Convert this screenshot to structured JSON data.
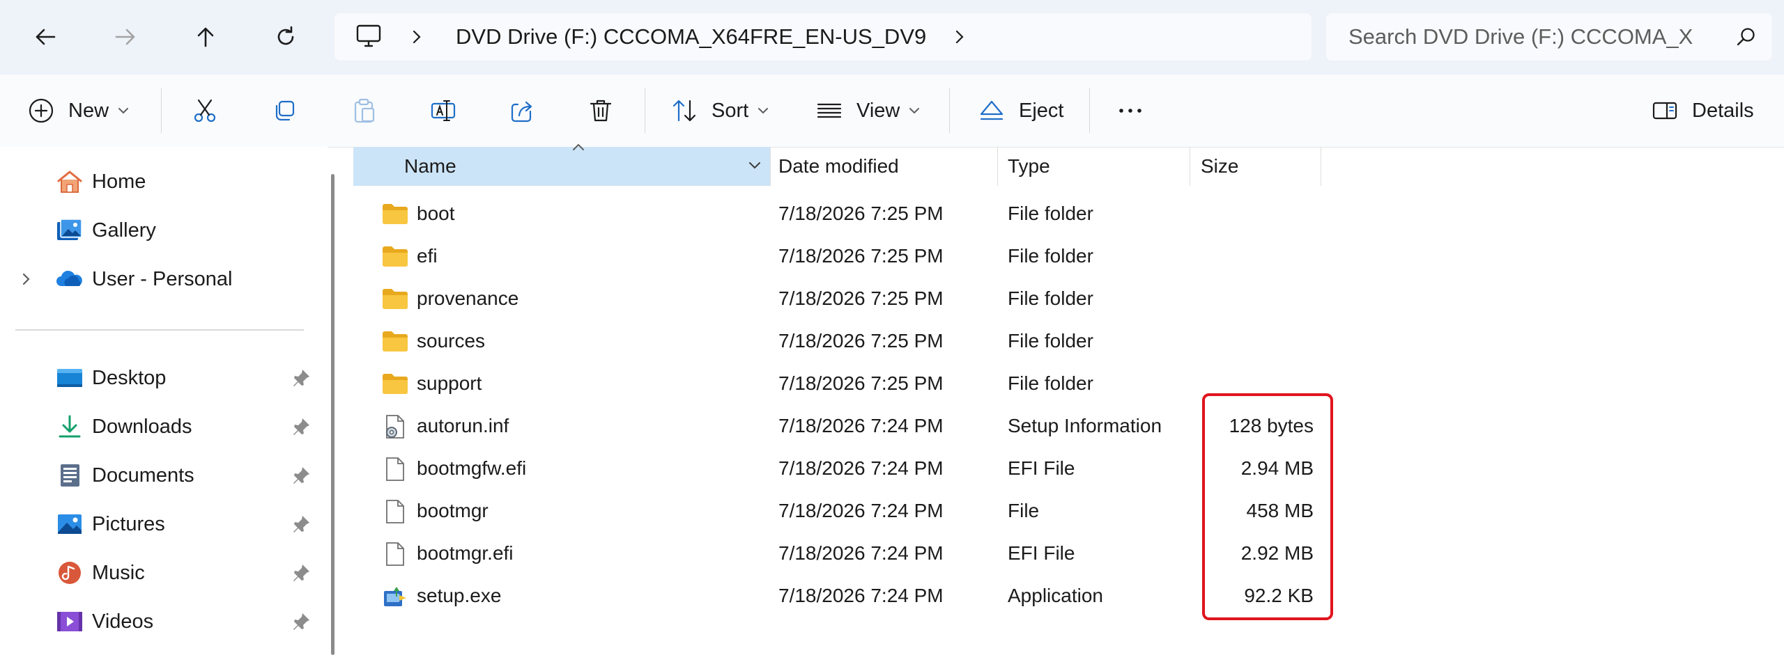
{
  "address": {
    "path": "DVD Drive (F:) CCCOMA_X64FRE_EN-US_DV9",
    "search_placeholder": "Search DVD Drive (F:) CCCOMA_X"
  },
  "toolbar": {
    "new_label": "New",
    "sort_label": "Sort",
    "view_label": "View",
    "eject_label": "Eject",
    "details_label": "Details"
  },
  "sidebar": {
    "top": [
      {
        "label": "Home",
        "icon": "home-icon"
      },
      {
        "label": "Gallery",
        "icon": "gallery-icon"
      },
      {
        "label": "User - Personal",
        "icon": "onedrive-icon"
      }
    ],
    "pinned": [
      {
        "label": "Desktop",
        "icon": "desktop-icon"
      },
      {
        "label": "Downloads",
        "icon": "downloads-icon"
      },
      {
        "label": "Documents",
        "icon": "documents-icon"
      },
      {
        "label": "Pictures",
        "icon": "pictures-icon"
      },
      {
        "label": "Music",
        "icon": "music-icon"
      },
      {
        "label": "Videos",
        "icon": "videos-icon"
      }
    ]
  },
  "columns": {
    "name": "Name",
    "date": "Date modified",
    "type": "Type",
    "size": "Size"
  },
  "files": [
    {
      "name": "boot",
      "date": "7/18/2026 7:25 PM",
      "type": "File folder",
      "size": "",
      "icon": "folder-icon"
    },
    {
      "name": "efi",
      "date": "7/18/2026 7:25 PM",
      "type": "File folder",
      "size": "",
      "icon": "folder-icon"
    },
    {
      "name": "provenance",
      "date": "7/18/2026 7:25 PM",
      "type": "File folder",
      "size": "",
      "icon": "folder-icon"
    },
    {
      "name": "sources",
      "date": "7/18/2026 7:25 PM",
      "type": "File folder",
      "size": "",
      "icon": "folder-icon"
    },
    {
      "name": "support",
      "date": "7/18/2026 7:25 PM",
      "type": "File folder",
      "size": "",
      "icon": "folder-icon"
    },
    {
      "name": "autorun.inf",
      "date": "7/18/2026 7:24 PM",
      "type": "Setup Information",
      "size": "128 bytes",
      "icon": "settings-file-icon"
    },
    {
      "name": "bootmgfw.efi",
      "date": "7/18/2026 7:24 PM",
      "type": "EFI File",
      "size": "2.94 MB",
      "icon": "file-icon"
    },
    {
      "name": "bootmgr",
      "date": "7/18/2026 7:24 PM",
      "type": "File",
      "size": "458 MB",
      "icon": "file-icon"
    },
    {
      "name": "bootmgr.efi",
      "date": "7/18/2026 7:24 PM",
      "type": "EFI File",
      "size": "2.92 MB",
      "icon": "file-icon"
    },
    {
      "name": "setup.exe",
      "date": "7/18/2026 7:24 PM",
      "type": "Application",
      "size": "92.2 KB",
      "icon": "setup-exe-icon"
    }
  ],
  "colors": {
    "accent": "#0067c0",
    "header_selected": "#cce4f7",
    "highlight_box": "#e0141e",
    "folder": "#f8c640"
  }
}
